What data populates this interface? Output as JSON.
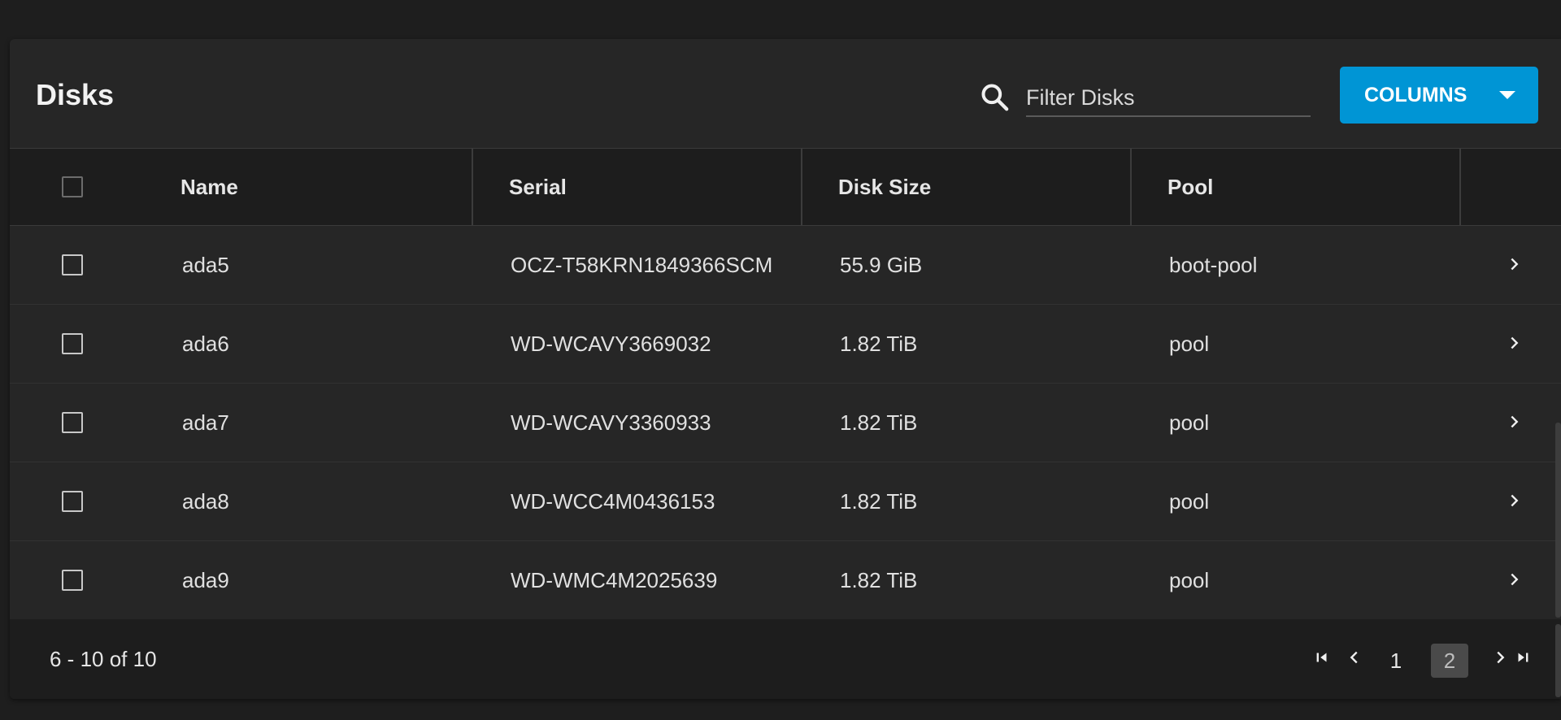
{
  "header": {
    "title": "Disks",
    "search_placeholder": "Filter Disks",
    "columns_button": "COLUMNS"
  },
  "table": {
    "columns": [
      "Name",
      "Serial",
      "Disk Size",
      "Pool"
    ],
    "rows": [
      {
        "name": "ada5",
        "serial": "OCZ-T58KRN1849366SCM",
        "size": "55.9 GiB",
        "pool": "boot-pool"
      },
      {
        "name": "ada6",
        "serial": "WD-WCAVY3669032",
        "size": "1.82 TiB",
        "pool": "pool"
      },
      {
        "name": "ada7",
        "serial": "WD-WCAVY3360933",
        "size": "1.82 TiB",
        "pool": "pool"
      },
      {
        "name": "ada8",
        "serial": "WD-WCC4M0436153",
        "size": "1.82 TiB",
        "pool": "pool"
      },
      {
        "name": "ada9",
        "serial": "WD-WMC4M2025639",
        "size": "1.82 TiB",
        "pool": "pool"
      }
    ]
  },
  "footer": {
    "range": "6 - 10 of 10",
    "pages": [
      "1",
      "2"
    ],
    "active_page": "2"
  },
  "icons": {
    "search": "search-icon",
    "dropdown": "caret-down-icon",
    "row_expand": "chevron-right-icon",
    "first": "first-page-icon",
    "prev": "chevron-left-icon",
    "next": "chevron-right-icon",
    "last": "last-page-icon"
  },
  "colors": {
    "accent": "#0095d5",
    "card": "#262626",
    "header_row": "#1d1d1d"
  }
}
